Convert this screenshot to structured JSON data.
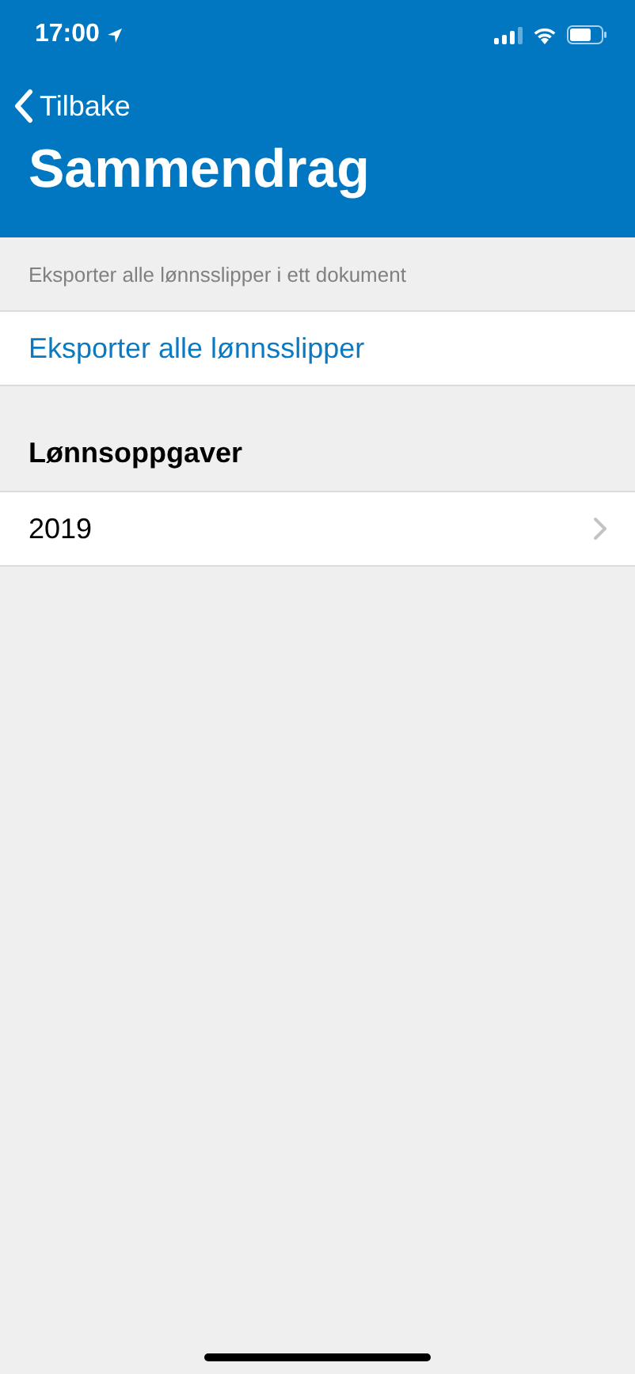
{
  "status_bar": {
    "time": "17:00"
  },
  "nav": {
    "back": "Tilbake",
    "title": "Sammendrag"
  },
  "sections": [
    {
      "header": {
        "kind": "note",
        "text": "Eksporter alle lønnsslipper i ett dokument"
      },
      "rows": [
        {
          "label": "Eksporter alle lønnsslipper",
          "kind": "action"
        }
      ]
    },
    {
      "header": {
        "kind": "title",
        "text": "Lønnsoppgaver"
      },
      "rows": [
        {
          "label": "2019",
          "kind": "disclosure"
        }
      ]
    }
  ]
}
